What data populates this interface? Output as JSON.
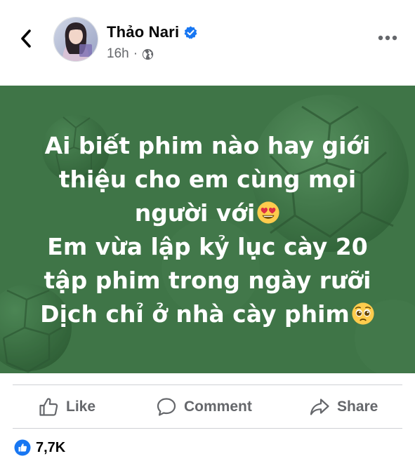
{
  "header": {
    "author_name": "Thảo Nari",
    "time_ago": "16h",
    "separator": "·",
    "privacy_icon": "globe-icon",
    "back_icon": "chevron-left-icon",
    "more_icon": "more-dots-icon",
    "verified_icon": "verified-badge-icon"
  },
  "post": {
    "background_color": "#3f7547",
    "lines": [
      "Ai biết phim nào hay giới",
      "thiệu cho em cùng mọi",
      "người với",
      "Em vừa lập kỷ lục cày 20",
      "tập phim trong ngày rưỡi",
      "Dịch chỉ ở nhà cày phim"
    ],
    "emojis": {
      "line3": "heart-eyes-emoji",
      "line6": "pleading-face-emoji"
    }
  },
  "actions": {
    "like": {
      "label": "Like",
      "icon": "thumbs-up-icon"
    },
    "comment": {
      "label": "Comment",
      "icon": "comment-bubble-icon"
    },
    "share": {
      "label": "Share",
      "icon": "share-arrow-icon"
    }
  },
  "reactions": {
    "count": "7,7K",
    "icon": "like-reaction-icon"
  },
  "colors": {
    "facebook_blue": "#1877f2",
    "secondary_text": "#65676b",
    "primary_text": "#050505"
  }
}
